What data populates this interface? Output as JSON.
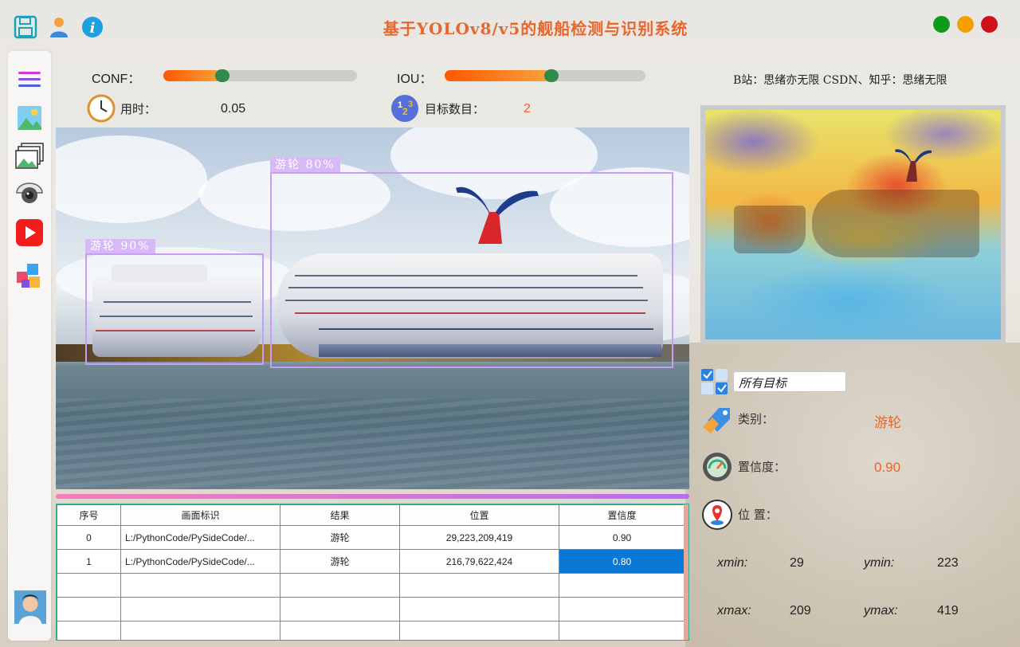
{
  "app": {
    "title": "基于YOLOv8/v5的舰船检测与识别系统",
    "credits": "B站：思绪亦无限  CSDN、知乎：思绪无限"
  },
  "toolbar": {
    "icons": [
      "save-icon",
      "user-icon",
      "info-icon"
    ]
  },
  "window_buttons": {
    "colors": [
      "#0e9b1a",
      "#f6a000",
      "#d0101a"
    ]
  },
  "sidebar": {
    "items": [
      "menu-icon",
      "image-icon",
      "image-folder-icon",
      "camera-icon",
      "video-icon",
      "model-icon",
      "avatar"
    ]
  },
  "controls": {
    "conf_label": "CONF：",
    "conf_value": 0.27,
    "iou_label": "IOU：",
    "iou_value": 0.5,
    "time_label": "用时：",
    "time_value": "0.05",
    "count_label": "目标数目：",
    "count_value": "2"
  },
  "detection": {
    "boxes": [
      {
        "label": "游轮  90%"
      },
      {
        "label": "游轮  80%"
      }
    ],
    "progress": 1.0
  },
  "table": {
    "headers": [
      "序号",
      "画面标识",
      "结果",
      "位置",
      "置信度"
    ],
    "rows": [
      [
        "0",
        "L:/PythonCode/PySideCode/...",
        "游轮",
        "29,223,209,419",
        "0.90"
      ],
      [
        "1",
        "L:/PythonCode/PySideCode/...",
        "游轮",
        "216,79,622,424",
        "0.80"
      ]
    ],
    "selected_row": 1,
    "empty_rows": 3
  },
  "details": {
    "filter_value": "所有目标",
    "class_label": "类别：",
    "class_value": "游轮",
    "conf_label": "置信度：",
    "conf_value": "0.90",
    "position_label": "位 置：",
    "xmin_label": "xmin:",
    "xmin_value": "29",
    "ymin_label": "ymin:",
    "ymin_value": "223",
    "xmax_label": "xmax:",
    "xmax_value": "209",
    "ymax_label": "ymax:",
    "ymax_value": "419"
  },
  "colors": {
    "accent": "#e8662c",
    "table_border": "#2fb08a",
    "bbox": "#c79ef3",
    "selection": "#0a78d7"
  }
}
